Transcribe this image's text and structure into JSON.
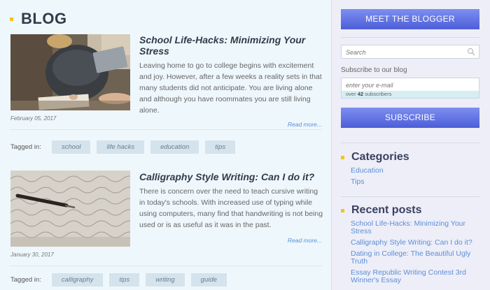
{
  "blog": {
    "title": "BLOG"
  },
  "posts": [
    {
      "title": "School Life-Hacks: Minimizing Your Stress",
      "excerpt": "Leaving home to go to college begins with excitement and joy. However, after a few weeks a reality sets in that many students did not anticipate. You are living alone and although you have roommates you are still living alone.",
      "date": "February 05, 2017",
      "read_more": "Read more...",
      "tags_label": "Tagged in:",
      "tags": [
        "school",
        "life hacks",
        "education",
        "tips"
      ]
    },
    {
      "title": "Calligraphy Style Writing: Can I do it?",
      "excerpt": "There is concern over the need to teach cursive writing in today's schools. With increased use of typing while using computers, many find that handwriting is not being used or is as useful as it was in the past.",
      "date": "January 30, 2017",
      "read_more": "Read more...",
      "tags_label": "Tagged in:",
      "tags": [
        "calligraphy",
        "tips",
        "writing",
        "guide"
      ]
    }
  ],
  "sidebar": {
    "meet_button": "MEET THE BLOGGER",
    "search_placeholder": "Search",
    "subscribe_label": "Subscribe to our blog",
    "email_placeholder": "enter your e-mail",
    "subscribers_prefix": "over",
    "subscribers_count": "42",
    "subscribers_suffix": "subscribers",
    "subscribe_button": "SUBSCRIBE",
    "categories_title": "Categories",
    "categories": [
      "Education",
      "Tips"
    ],
    "recent_title": "Recent posts",
    "recent_posts": [
      "School Life-Hacks: Minimizing Your Stress",
      "Calligraphy Style Writing: Can I do it?",
      "Dating in College: The Beautiful Ugly Truth",
      "Essay Republic Writing Contest 3rd Winner's Essay"
    ]
  },
  "colors": {
    "accent_bullet": "#f5c518",
    "button_blue": "#5566dd",
    "link_blue": "#5a8fd6",
    "tag_bg": "#d4e3ec"
  }
}
